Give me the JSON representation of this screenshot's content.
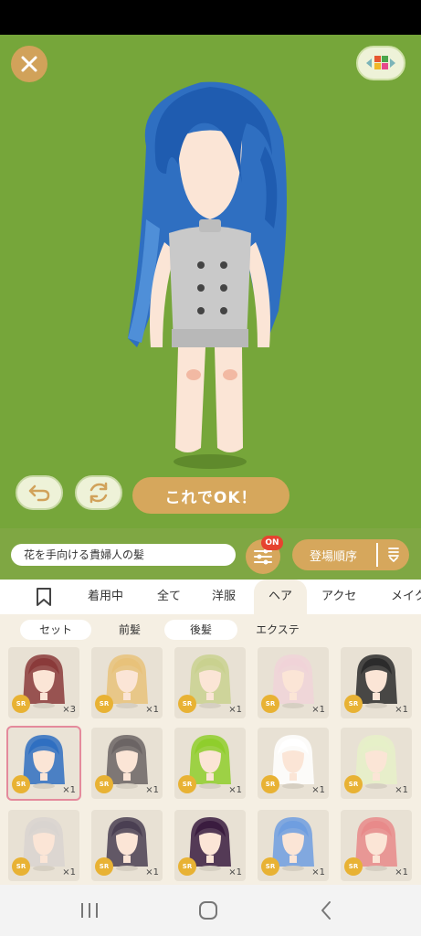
{
  "stage": {
    "bg": "#76a63a",
    "ok_label": "これでOK！"
  },
  "name_field": {
    "value": "花を手向ける貴婦人の髪"
  },
  "filter": {
    "badge": "ON"
  },
  "sort": {
    "label": "登場順序"
  },
  "category_tabs": [
    "着用中",
    "全て",
    "洋服",
    "ヘア",
    "アクセ",
    "メイク"
  ],
  "active_category": "ヘア",
  "sub_tabs": [
    "セット",
    "前髪",
    "後髪",
    "エクステ"
  ],
  "items": [
    {
      "rarity": "SR",
      "count": "×3",
      "hair": "#8a3a3a",
      "face": "#fbe5d6"
    },
    {
      "rarity": "SR",
      "count": "×1",
      "hair": "#e8c27a",
      "face": "#fbe5d6"
    },
    {
      "rarity": "SR",
      "count": "×1",
      "hair": "#c9d18f",
      "face": "#fbe5d6"
    },
    {
      "rarity": "SR",
      "count": "×1",
      "hair": "#f0d3d8",
      "face": "#fbe5d6"
    },
    {
      "rarity": "SR",
      "count": "×1",
      "hair": "#2b2b2b",
      "face": "#fbe5d6"
    },
    {
      "rarity": "SR",
      "count": "×1",
      "hair": "#2f6fc1",
      "face": "#fbe5d6"
    },
    {
      "rarity": "SR",
      "count": "×1",
      "hair": "#6b6464",
      "face": "#fbe5d6"
    },
    {
      "rarity": "SR",
      "count": "×1",
      "hair": "#8fce2c",
      "face": "#fbe5d6"
    },
    {
      "rarity": "SR",
      "count": "×1",
      "hair": "#ffffff",
      "face": "#fbe5d6"
    },
    {
      "rarity": "SR",
      "count": "×1",
      "hair": "#e6f0c8",
      "face": "#fbe5d6"
    },
    {
      "rarity": "SR",
      "count": "×1",
      "hair": "#d9d4d0",
      "face": "#fbe5d6"
    },
    {
      "rarity": "SR",
      "count": "×1",
      "hair": "#4a3f52",
      "face": "#fbe5d6"
    },
    {
      "rarity": "SR",
      "count": "×1",
      "hair": "#3a1c3f",
      "face": "#fbe5d6"
    },
    {
      "rarity": "SR",
      "count": "×1",
      "hair": "#6f9ee0",
      "face": "#fbe5d6"
    },
    {
      "rarity": "SR",
      "count": "×1",
      "hair": "#e88a8a",
      "face": "#fbe5d6"
    }
  ],
  "selected_index": 5,
  "icons": {
    "close": "close-icon",
    "grid": "color-grid-icon",
    "undo": "undo-icon",
    "shuffle": "shuffle-icon",
    "filter": "sliders-icon",
    "sort": "sort-icon",
    "bookmark": "bookmark-icon",
    "nav_recent": "recent-apps-icon",
    "nav_home": "home-icon",
    "nav_back": "back-icon"
  }
}
